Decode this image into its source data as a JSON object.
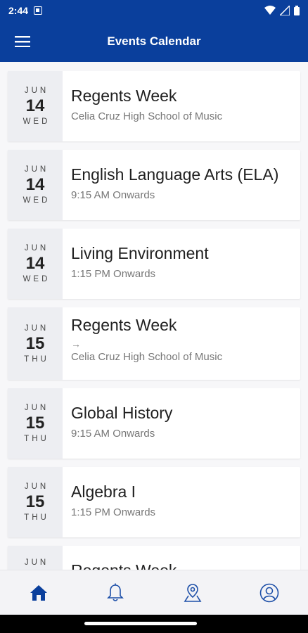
{
  "status": {
    "time": "2:44"
  },
  "appbar": {
    "title": "Events Calendar"
  },
  "events": [
    {
      "month": "JUN",
      "day": "14",
      "dow": "WED",
      "title": "Regents Week",
      "sub": "Celia Cruz High School of Music"
    },
    {
      "month": "JUN",
      "day": "14",
      "dow": "WED",
      "title": "English Language Arts (ELA)",
      "sub": "9:15 AM Onwards"
    },
    {
      "month": "JUN",
      "day": "14",
      "dow": "WED",
      "title": "Living Environment",
      "sub": "1:15 PM Onwards"
    },
    {
      "month": "JUN",
      "day": "15",
      "dow": "THU",
      "title": "Regents Week",
      "arrow": "→",
      "sub": "Celia Cruz High School of Music"
    },
    {
      "month": "JUN",
      "day": "15",
      "dow": "THU",
      "title": "Global History",
      "sub": "9:15 AM Onwards"
    },
    {
      "month": "JUN",
      "day": "15",
      "dow": "THU",
      "title": "Algebra I",
      "sub": "1:15 PM Onwards"
    },
    {
      "month": "JUN",
      "day": "",
      "dow": "",
      "title": "Regents Week",
      "sub": ""
    }
  ],
  "nav": [
    "home-icon",
    "bell-icon",
    "location-icon",
    "profile-icon"
  ],
  "colors": {
    "primary": "#0a3f9c",
    "nav_active": "#0a3f9c",
    "nav_inactive": "#1d4fa8"
  }
}
